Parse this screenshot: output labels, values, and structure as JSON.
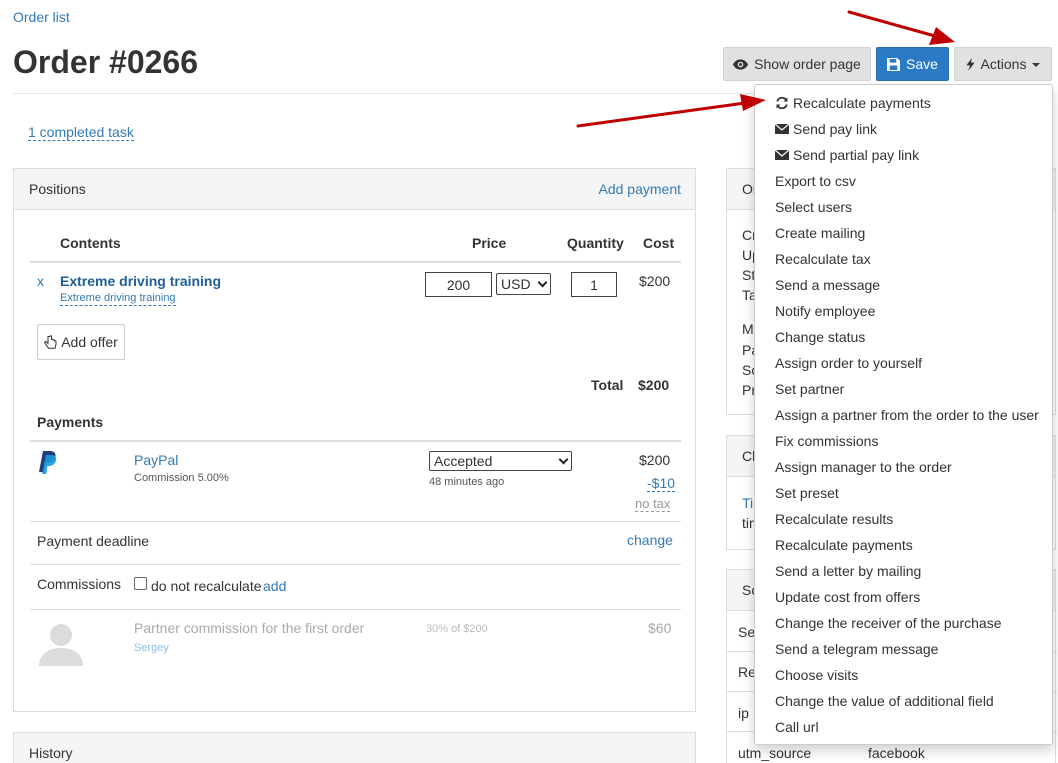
{
  "breadcrumb": {
    "order_list": "Order list"
  },
  "page": {
    "title": "Order #0266"
  },
  "toolbar": {
    "show_order_page": "Show order page",
    "save": "Save",
    "actions": "Actions"
  },
  "task_link": "1 completed task",
  "positions": {
    "title": "Positions",
    "add_payment": "Add payment",
    "headers": {
      "contents": "Contents",
      "price": "Price",
      "quantity": "Quantity",
      "cost": "Cost"
    },
    "item": {
      "remove": "x",
      "name": "Extreme driving training",
      "sub": "Extreme driving training",
      "price": "200",
      "currency": "USD",
      "quantity": "1",
      "cost": "$200"
    },
    "add_offer": "Add offer",
    "total_label": "Total",
    "total_value": "$200"
  },
  "payments": {
    "title": "Payments",
    "method": "PayPal",
    "commission": "Commission 5.00%",
    "status": "Accepted",
    "time": "48 minutes ago",
    "amount": "$200",
    "fee": "-$10",
    "tax": "no tax"
  },
  "deadline": {
    "label": "Payment deadline",
    "action": "change"
  },
  "commissions": {
    "label": "Commissions",
    "checkbox_label": "do not recalculate",
    "add": "add",
    "partner_text": "Partner commission for the first order",
    "partner_name": "Sergey",
    "percent": "30% of $200",
    "value": "$60"
  },
  "history": {
    "title": "History"
  },
  "side": {
    "order_heading": "Or",
    "order_rows": [
      "Cr",
      "Up",
      "St",
      "Ta",
      "M",
      "Pa",
      "So",
      "Pr"
    ],
    "ch_heading": "Cl",
    "ch_link": "Ti",
    "ch_text": "tim",
    "sc_heading": "Sc",
    "sc_rows": [
      "Ses",
      "Ref",
      "ip"
    ],
    "utm_source_label": "utm_source",
    "utm_source_value": "facebook"
  },
  "actions_menu": [
    {
      "label": "Recalculate payments",
      "icon": "refresh-icon"
    },
    {
      "label": "Send pay link",
      "icon": "envelope-icon"
    },
    {
      "label": "Send partial pay link",
      "icon": "envelope-icon"
    },
    {
      "label": "Export to csv"
    },
    {
      "label": "Select users"
    },
    {
      "label": "Create mailing"
    },
    {
      "label": "Recalculate tax"
    },
    {
      "label": "Send a message"
    },
    {
      "label": "Notify employee"
    },
    {
      "label": "Change status"
    },
    {
      "label": "Assign order to yourself"
    },
    {
      "label": "Set partner"
    },
    {
      "label": "Assign a partner from the order to the user"
    },
    {
      "label": "Fix commissions"
    },
    {
      "label": "Assign manager to the order"
    },
    {
      "label": "Set preset"
    },
    {
      "label": "Recalculate results"
    },
    {
      "label": "Recalculate payments"
    },
    {
      "label": "Send a letter by mailing"
    },
    {
      "label": "Update cost from offers"
    },
    {
      "label": "Change the receiver of the purchase"
    },
    {
      "label": "Send a telegram message"
    },
    {
      "label": "Choose visits"
    },
    {
      "label": "Change the value of additional field"
    },
    {
      "label": "Call url"
    }
  ],
  "colors": {
    "primary": "#2a7ac6",
    "link": "#337ab7",
    "arrow": "#c00000",
    "paypal_dark": "#253b80",
    "paypal_light": "#179bd7"
  }
}
